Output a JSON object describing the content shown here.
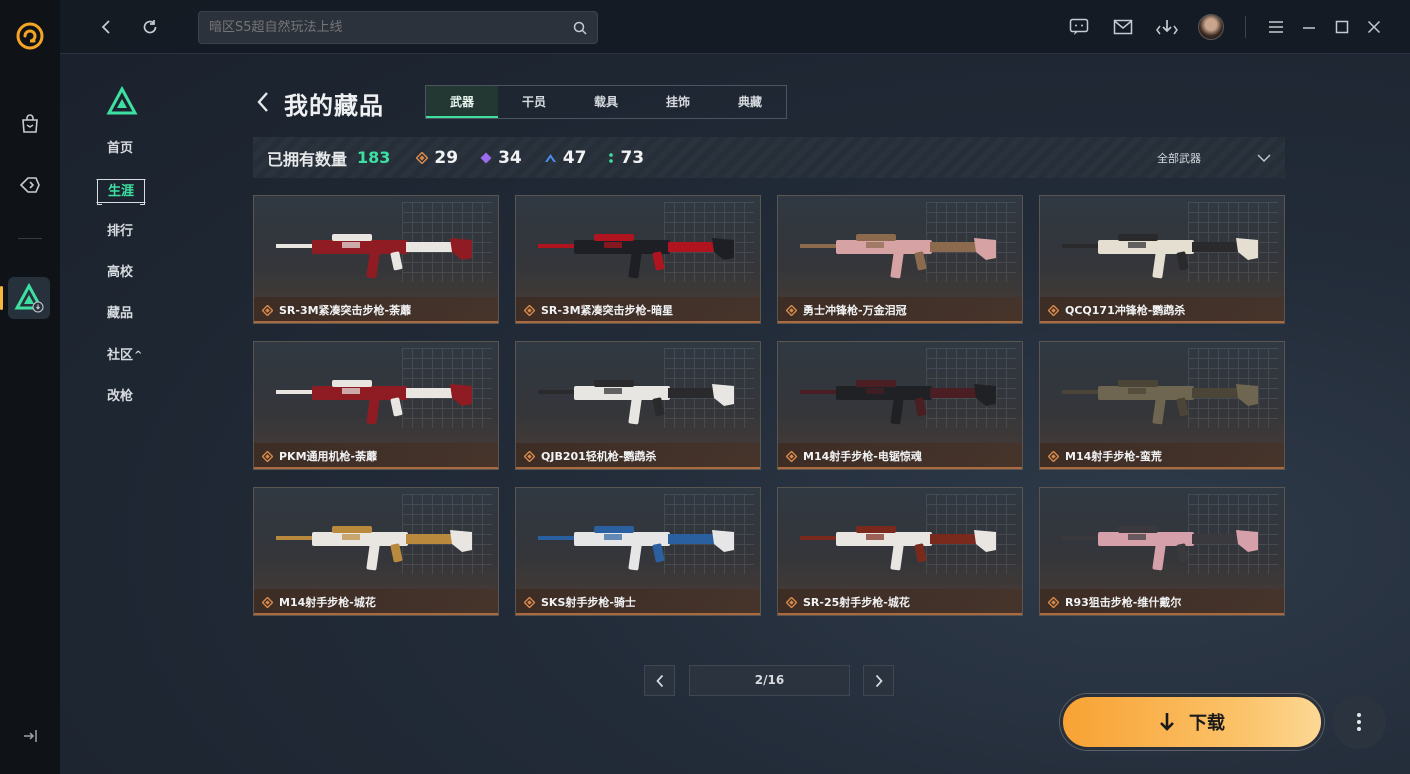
{
  "search": {
    "placeholder": "暗区S5超自然玩法上线"
  },
  "sidebar": {
    "items": [
      {
        "label": "首页"
      },
      {
        "label": "生涯",
        "active": true
      },
      {
        "label": "排行"
      },
      {
        "label": "高校"
      },
      {
        "label": "藏品"
      },
      {
        "label": "社区",
        "chevron": "^"
      },
      {
        "label": "改枪"
      }
    ]
  },
  "page": {
    "title": "我的藏品"
  },
  "tabs": [
    {
      "label": "武器",
      "active": true
    },
    {
      "label": "干员"
    },
    {
      "label": "载具"
    },
    {
      "label": "挂饰"
    },
    {
      "label": "典藏"
    }
  ],
  "stats": {
    "owned_label": "已拥有数量",
    "owned_total": "183",
    "tiers": [
      {
        "icon": "orange-diamond-icon",
        "color": "#d98a4a",
        "value": "29"
      },
      {
        "icon": "purple-diamond-icon",
        "color": "#9b6cf0",
        "value": "34"
      },
      {
        "icon": "blue-chevron-icon",
        "color": "#4a8ee8",
        "value": "47"
      },
      {
        "icon": "green-dots-icon",
        "color": "#3ee0a1",
        "value": "73"
      }
    ],
    "filter_label": "全部武器"
  },
  "cards": [
    {
      "name": "SR-3M紧凑突击步枪-荼蘼",
      "palette": [
        "#8e1c22",
        "#e9e6e2"
      ]
    },
    {
      "name": "SR-3M紧凑突击步枪-暗星",
      "palette": [
        "#1d1f24",
        "#b0141f"
      ]
    },
    {
      "name": "勇士冲锋枪-万金泪冠",
      "palette": [
        "#d7a2a4",
        "#8c6a4e"
      ]
    },
    {
      "name": "QCQ171冲锋枪-鹦鹉杀",
      "palette": [
        "#e5dfd2",
        "#2a2a2c"
      ]
    },
    {
      "name": "PKM通用机枪-荼蘼",
      "palette": [
        "#8e1c22",
        "#e9e6e2"
      ]
    },
    {
      "name": "QJB201轻机枪-鹦鹉杀",
      "palette": [
        "#e8e6e2",
        "#2a2a2c"
      ]
    },
    {
      "name": "M14射手步枪-电锯惊魂",
      "palette": [
        "#1f2125",
        "#4a1e22"
      ]
    },
    {
      "name": "M14射手步枪-蛮荒",
      "palette": [
        "#6e6650",
        "#4a4536"
      ]
    },
    {
      "name": "M14射手步枪-城花",
      "palette": [
        "#e9e6e2",
        "#b98a3e"
      ]
    },
    {
      "name": "SKS射手步枪-骑士",
      "palette": [
        "#e6e6e6",
        "#2a5fa0"
      ]
    },
    {
      "name": "SR-25射手步枪-城花",
      "palette": [
        "#e9e6e2",
        "#7a2a1c"
      ]
    },
    {
      "name": "R93狙击步枪-维什戴尔",
      "palette": [
        "#d6a0aa",
        "#3a3a3e"
      ]
    }
  ],
  "pagination": {
    "label": "2/16"
  },
  "download": {
    "label": "下载"
  }
}
